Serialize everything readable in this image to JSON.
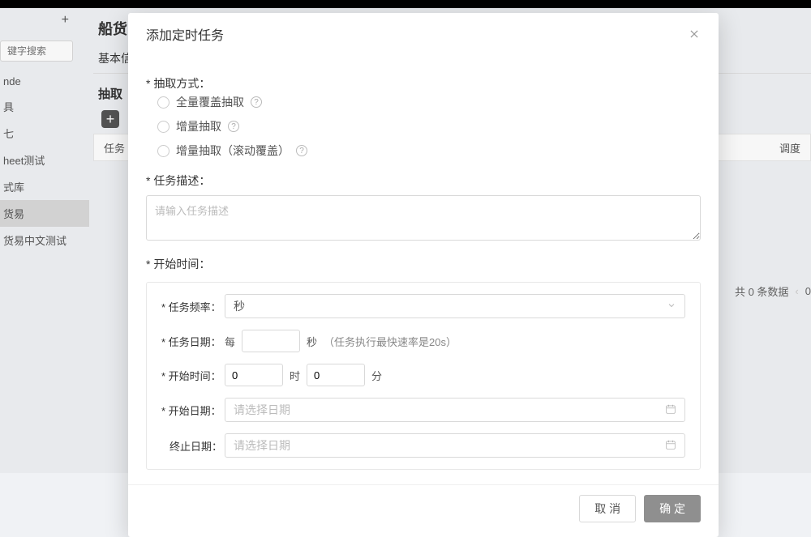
{
  "bg": {
    "title_prefix": "船货",
    "search_placeholder": "键字搜索",
    "tabs_first": "基本信",
    "sub_head": "抽取",
    "table_left": "任务",
    "table_right": "调度",
    "side_items": [
      "nde",
      "具",
      "七",
      "heet测试",
      "式库",
      "货易",
      "货易中文测试"
    ],
    "side_active": 5,
    "footer_count": "共 0 条数据",
    "footer_page": "0"
  },
  "modal": {
    "title": "添加定时任务",
    "extract_label": "抽取方式：",
    "radios": [
      "全量覆盖抽取",
      "增量抽取",
      "增量抽取（滚动覆盖）"
    ],
    "desc_label": "任务描述：",
    "desc_placeholder": "请输入任务描述",
    "start_section": "开始时间：",
    "freq_label": "任务频率：",
    "freq_value": "秒",
    "date_row_label": "任务日期：",
    "date_row_prefix": "每",
    "date_row_unit": "秒",
    "date_row_hint": "（任务执行最快速率是20s）",
    "start_time_label": "开始时间：",
    "start_hour": "0",
    "start_hour_unit": "时",
    "start_min": "0",
    "start_min_unit": "分",
    "start_date_label": "开始日期：",
    "end_date_label": "终止日期：",
    "date_placeholder": "请选择日期",
    "cancel": "取 消",
    "ok": "确 定"
  }
}
